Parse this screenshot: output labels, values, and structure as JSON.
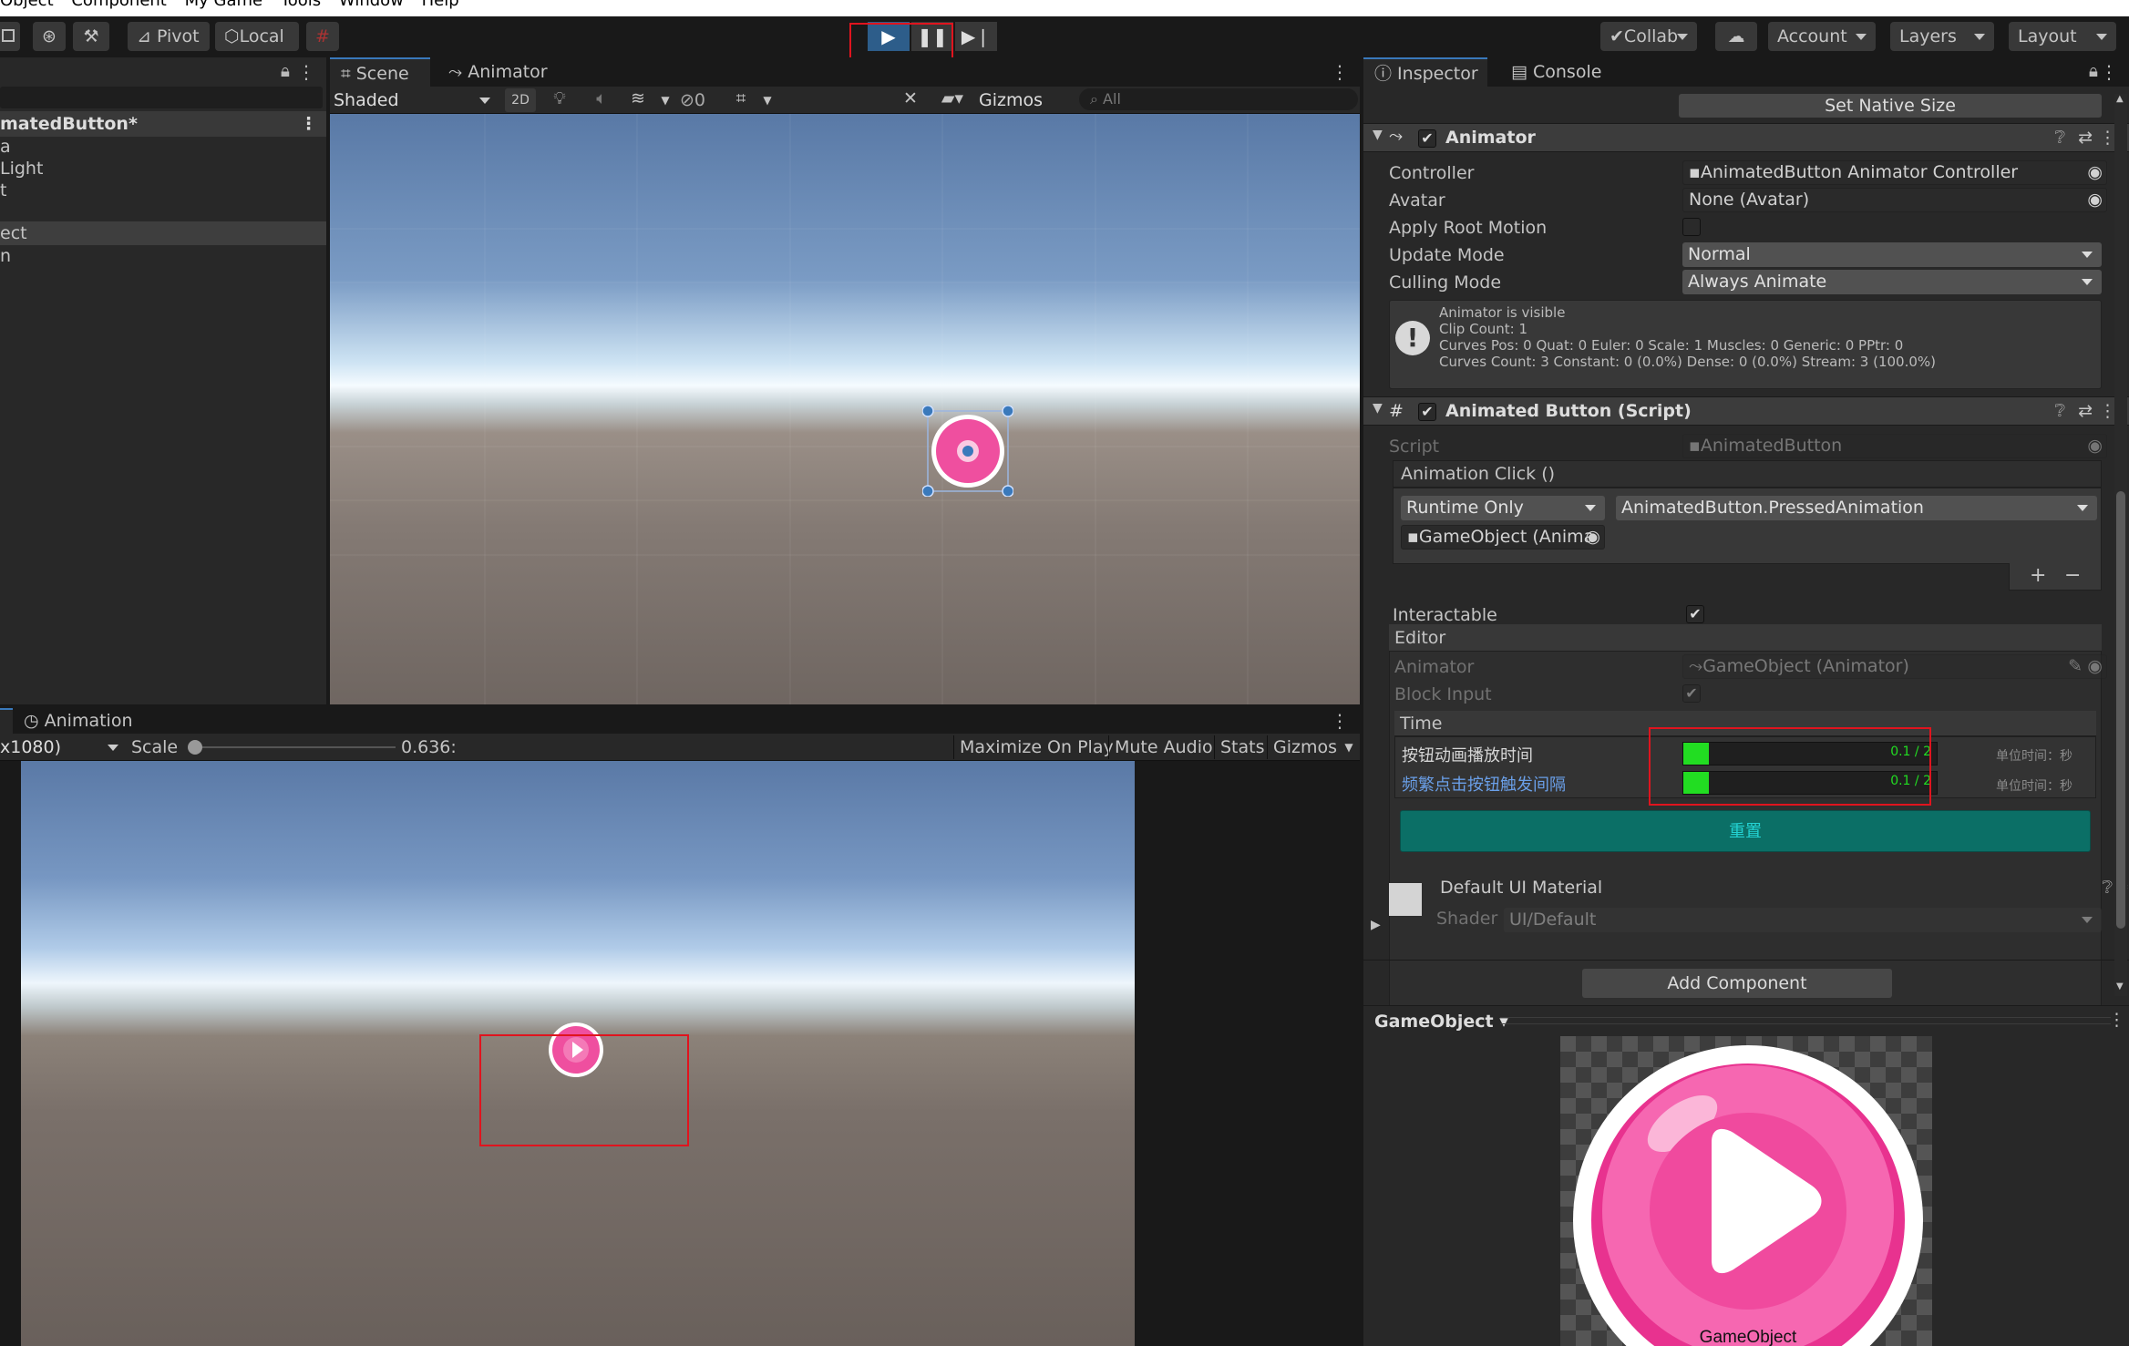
{
  "menubar": {
    "items": [
      "Object",
      "Component",
      "My Game",
      "Tools",
      "Window",
      "Help"
    ]
  },
  "toolbar": {
    "pivot": "Pivot",
    "local": "Local",
    "collab": "Collab",
    "account": "Account",
    "layers": "Layers",
    "layout": "Layout"
  },
  "hierarchy": {
    "root": "matedButton*",
    "items": [
      "a",
      "Light",
      "t",
      "",
      "ect",
      "n"
    ]
  },
  "scene": {
    "tab_scene": "Scene",
    "tab_animator": "Animator",
    "shading": "Shaded",
    "mode_2d": "2D",
    "hidden_count": "0",
    "gizmos": "Gizmos",
    "search_placeholder": "All"
  },
  "game": {
    "tab_animation": "Animation",
    "resolution": "x1080)",
    "scale_label": "Scale",
    "scale_value": "0.636:",
    "maximize": "Maximize On Play",
    "mute": "Mute Audio",
    "stats": "Stats",
    "gizmos": "Gizmos"
  },
  "inspector": {
    "tab_inspector": "Inspector",
    "tab_console": "Console",
    "set_native_size": "Set Native Size",
    "animator": {
      "title": "Animator",
      "controller_label": "Controller",
      "controller_value": "AnimatedButton Animator Controller",
      "avatar_label": "Avatar",
      "avatar_value": "None (Avatar)",
      "root_motion_label": "Apply Root Motion",
      "update_mode_label": "Update Mode",
      "update_mode_value": "Normal",
      "culling_label": "Culling Mode",
      "culling_value": "Always Animate",
      "info": [
        "Animator is visible",
        "Clip Count: 1",
        "Curves Pos: 0 Quat: 0 Euler: 0 Scale: 1 Muscles: 0 Generic: 0 PPtr: 0",
        "Curves Count: 3 Constant: 0 (0.0%) Dense: 0 (0.0%) Stream: 3 (100.0%)"
      ]
    },
    "script": {
      "title": "Animated Button (Script)",
      "script_label": "Script",
      "script_value": "AnimatedButton",
      "event_label": "Animation Click ()",
      "runtime": "Runtime Only",
      "function": "AnimatedButton.PressedAnimation",
      "object": "GameObject (Anima",
      "interactable_label": "Interactable",
      "editor_header": "Editor",
      "animator_label": "Animator",
      "animator_value": "GameObject (Animator)",
      "block_input_label": "Block Input",
      "time_header": "Time",
      "sliders": [
        {
          "label": "按钮动画播放时间",
          "value": "0.1 / 2",
          "unit": "单位时间：秒",
          "fraction": 0.05
        },
        {
          "label": "频繁点击按钮触发间隔",
          "value": "0.1 / 2",
          "unit": "单位时间：秒",
          "fraction": 0.05
        }
      ],
      "reset": "重置"
    },
    "material": {
      "title": "Default UI Material",
      "shader_label": "Shader",
      "shader_value": "UI/Default"
    },
    "add_component": "Add Component",
    "preview_dropdown": "GameObject",
    "preview_label": "GameObject"
  },
  "colors": {
    "accent": "#3a79bb",
    "highlight_red": "#e0141e",
    "slider_green": "#22dd22",
    "reset_teal": "#0b6f66",
    "pink": "#ef4f9f"
  }
}
